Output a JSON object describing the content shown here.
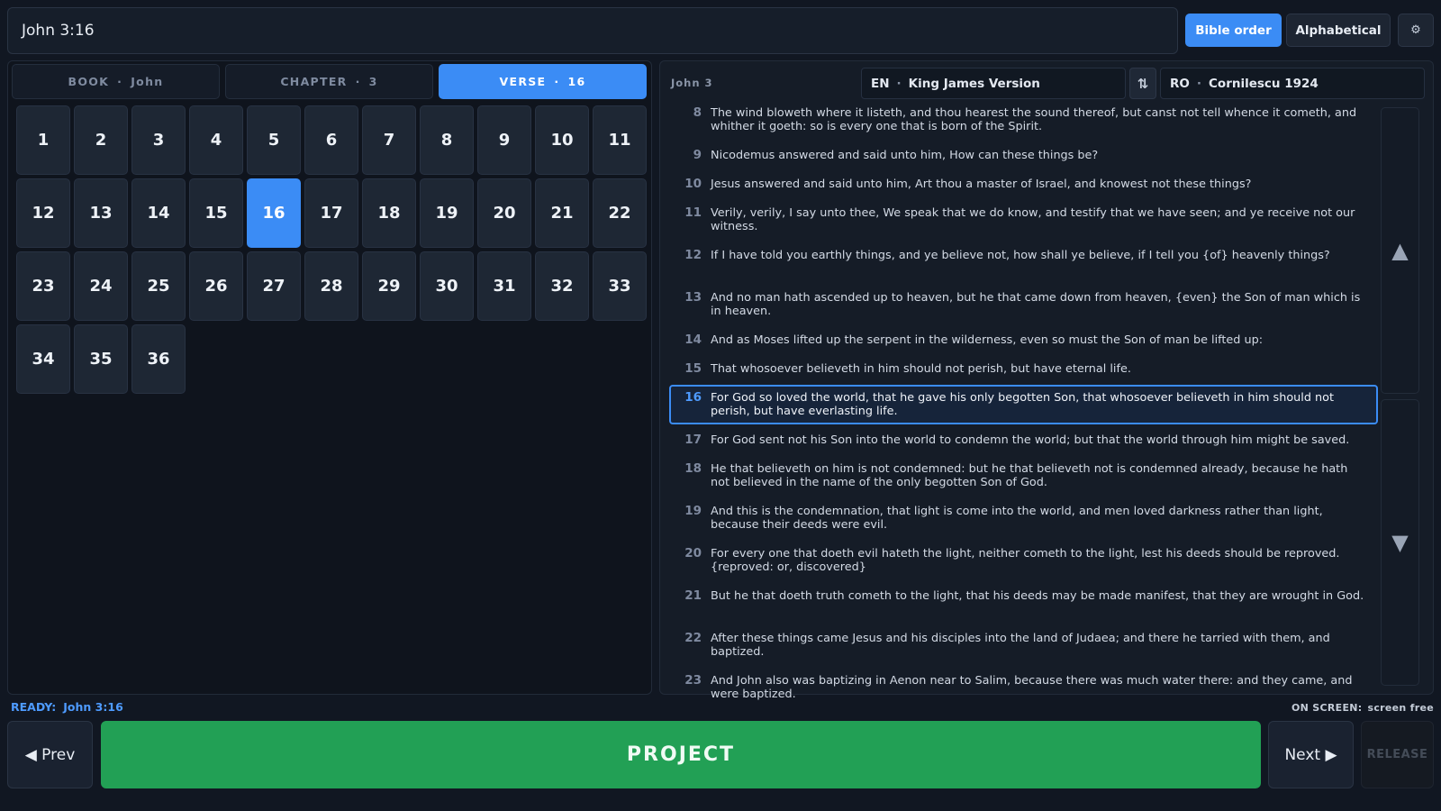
{
  "search": {
    "value": "John 3:16"
  },
  "order_buttons": {
    "bible_order": "Bible order",
    "alphabetical": "Alphabetical"
  },
  "settings_icon": "gear-icon",
  "settings_glyph": "⚙",
  "tabs": {
    "book": {
      "label": "BOOK",
      "value": "John"
    },
    "chapter": {
      "label": "CHAPTER",
      "value": "3"
    },
    "verse": {
      "label": "VERSE",
      "value": "16"
    },
    "separator": "·"
  },
  "verse_grid": {
    "numbers": [
      "1",
      "2",
      "3",
      "4",
      "5",
      "6",
      "7",
      "8",
      "9",
      "10",
      "11",
      "12",
      "13",
      "14",
      "15",
      "16",
      "17",
      "18",
      "19",
      "20",
      "21",
      "22",
      "23",
      "24",
      "25",
      "26",
      "27",
      "28",
      "29",
      "30",
      "31",
      "32",
      "33",
      "34",
      "35",
      "36"
    ],
    "selected": "16"
  },
  "reader": {
    "reference": "John 3",
    "primary": {
      "code": "EN",
      "name": "King James Version"
    },
    "secondary": {
      "code": "RO",
      "name": "Cornilescu 1924"
    },
    "swap_glyph": "⇅",
    "verses": [
      {
        "num": "8",
        "text": "The wind bloweth where it listeth, and thou hearest the sound thereof, but canst not tell whence it cometh, and whither it goeth: so is every one that is born of the Spirit."
      },
      {
        "num": "9",
        "text": "Nicodemus answered and said unto him, How can these things be?"
      },
      {
        "num": "10",
        "text": "Jesus answered and said unto him, Art thou a master of Israel, and knowest not these things?"
      },
      {
        "num": "11",
        "text": "Verily, verily, I say unto thee, We speak that we do know, and testify that we have seen; and ye receive not our witness."
      },
      {
        "num": "12",
        "text": "If I have told you earthly things, and ye believe not, how shall ye believe, if I tell you {of} heavenly things?"
      },
      {
        "num": "13",
        "text": "And no man hath ascended up to heaven, but he that came down from heaven, {even} the Son of man which is in heaven."
      },
      {
        "num": "14",
        "text": "And as Moses lifted up the serpent in the wilderness, even so must the Son of man be lifted up:"
      },
      {
        "num": "15",
        "text": "That whosoever believeth in him should not perish, but have eternal life."
      },
      {
        "num": "16",
        "text": "For God so loved the world, that he gave his only begotten Son, that whosoever believeth in him should not perish, but have everlasting life."
      },
      {
        "num": "17",
        "text": "For God sent not his Son into the world to condemn the world; but that the world through him might be saved."
      },
      {
        "num": "18",
        "text": "He that believeth on him is not condemned: but he that believeth not is condemned already, because he hath not believed in the name of the only begotten Son of God."
      },
      {
        "num": "19",
        "text": "And this is the condemnation, that light is come into the world, and men loved darkness rather than light, because their deeds were evil."
      },
      {
        "num": "20",
        "text": "For every one that doeth evil hateth the light, neither cometh to the light, lest his deeds should be reproved. {reproved: or, discovered}"
      },
      {
        "num": "21",
        "text": "But he that doeth truth cometh to the light, that his deeds may be made manifest, that they are wrought in God."
      },
      {
        "num": "22",
        "text": "After these things came Jesus and his disciples into the land of Judaea; and there he tarried with them, and baptized."
      },
      {
        "num": "23",
        "text": "And John also was baptizing in Aenon near to Salim, because there was much water there: and they came, and were baptized."
      }
    ],
    "scroll_up_glyph": "▲",
    "scroll_down_glyph": "▼"
  },
  "status": {
    "label": "READY:",
    "reference": "John 3:16",
    "on_screen_label": "ON SCREEN:",
    "on_screen_value": "screen free"
  },
  "bottom": {
    "prev": "◀ Prev",
    "project": "PROJECT",
    "next": "Next ▶",
    "release": "RELEASE"
  },
  "colors": {
    "accent": "#3b8cf5",
    "project": "#22a055",
    "background": "#111722"
  }
}
